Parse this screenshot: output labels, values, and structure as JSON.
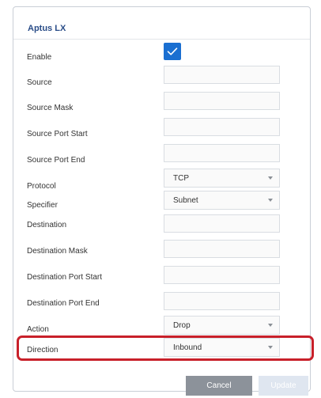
{
  "dialog": {
    "title": "Aptus LX"
  },
  "form": {
    "enable": {
      "label": "Enable",
      "checked": true
    },
    "source": {
      "label": "Source",
      "value": ""
    },
    "source_mask": {
      "label": "Source Mask",
      "value": ""
    },
    "source_port_start": {
      "label": "Source Port Start",
      "value": ""
    },
    "source_port_end": {
      "label": "Source Port End",
      "value": ""
    },
    "protocol": {
      "label": "Protocol",
      "value": "TCP"
    },
    "specifier": {
      "label": "Specifier",
      "value": "Subnet"
    },
    "destination": {
      "label": "Destination",
      "value": ""
    },
    "destination_mask": {
      "label": "Destination Mask",
      "value": ""
    },
    "destination_port_start": {
      "label": "Destination Port Start",
      "value": ""
    },
    "destination_port_end": {
      "label": "Destination Port End",
      "value": ""
    },
    "action": {
      "label": "Action",
      "value": "Drop"
    },
    "direction": {
      "label": "Direction",
      "value": "Inbound"
    }
  },
  "buttons": {
    "cancel": "Cancel",
    "update": "Update"
  },
  "colors": {
    "accent": "#1a6fd1",
    "title": "#2a4d88",
    "highlight": "#c8202a",
    "cancel_bg": "#8c929a",
    "update_bg_disabled": "#dfe6f0"
  },
  "icons": {
    "enable_checkbox": "checkmark-icon",
    "dropdown": "chevron-down-icon"
  }
}
